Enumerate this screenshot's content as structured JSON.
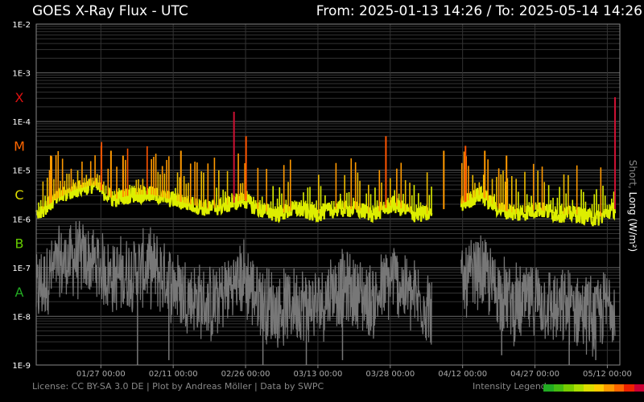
{
  "header": {
    "title": "GOES X-Ray Flux - UTC",
    "range": "From: 2025-01-13 14:26  /  To: 2025-05-14 14:26"
  },
  "footer": {
    "credits": "License: CC BY-SA 3.0 DE | Plot by Andreas Möller | Data by SWPC",
    "legend_title": "Intensity Legend",
    "legend_colors": [
      "#22aa22",
      "#44bb11",
      "#77cc00",
      "#aadd00",
      "#dddd00",
      "#ffcc00",
      "#ff9900",
      "#ff6600",
      "#ee2200",
      "#cc0033",
      "#aa0066",
      "#880088"
    ]
  },
  "axis": {
    "right_label_short": "Short",
    "right_label_sep": ", ",
    "right_label_long": "Long (W/m²)"
  },
  "chart_data": {
    "type": "line",
    "title": "GOES X-Ray Flux - UTC",
    "x_range": [
      "2025-01-13 14:26",
      "2025-05-14 14:26"
    ],
    "x_ticks": [
      "01/27 00:00",
      "02/11 00:00",
      "02/26 00:00",
      "03/13 00:00",
      "03/28 00:00",
      "04/12 00:00",
      "04/27 00:00",
      "05/12 00:00"
    ],
    "x_tick_days": [
      13.4,
      28.4,
      43.4,
      58.4,
      73.4,
      88.4,
      103.4,
      118.4
    ],
    "y_scale": "log",
    "ylim": [
      1e-09,
      0.01
    ],
    "y_ticks": [
      "1E-2",
      "1E-3",
      "1E-4",
      "1E-5",
      "1E-6",
      "1E-7",
      "1E-8",
      "1E-9"
    ],
    "y_tick_exps": [
      -2,
      -3,
      -4,
      -5,
      -6,
      -7,
      -8,
      -9
    ],
    "classes": [
      {
        "label": "X",
        "exp": -3.5,
        "color": "#dd1111"
      },
      {
        "label": "M",
        "exp": -4.5,
        "color": "#ff6600"
      },
      {
        "label": "C",
        "exp": -5.5,
        "color": "#dddd00"
      },
      {
        "label": "B",
        "exp": -6.5,
        "color": "#66cc00"
      },
      {
        "label": "A",
        "exp": -7.5,
        "color": "#22aa22"
      }
    ],
    "ylabel": "Short, Long (W/m²)",
    "grid": true,
    "series": [
      {
        "name": "Long",
        "color": "#ddee00",
        "x_days": [
          0,
          4,
          8,
          12,
          16,
          20,
          24,
          28,
          32,
          36,
          40,
          43,
          46,
          50,
          54,
          58,
          62,
          66,
          70,
          74,
          78,
          82,
          84,
          88,
          92,
          96,
          100,
          104,
          108,
          112,
          116,
          120
        ],
        "log_flux": [
          -5.9,
          -5.6,
          -5.4,
          -5.3,
          -5.6,
          -5.5,
          -5.5,
          -5.6,
          -5.7,
          -5.8,
          -5.7,
          -5.6,
          -5.8,
          -5.9,
          -5.8,
          -5.9,
          -5.8,
          -5.8,
          -5.9,
          -5.7,
          -5.9,
          -5.9,
          null,
          -5.7,
          -5.5,
          -5.8,
          -5.9,
          -5.8,
          -5.9,
          -5.9,
          -6.0,
          -5.8
        ],
        "peaks": [
          {
            "day": 3.0,
            "log_flux": -4.7
          },
          {
            "day": 13.5,
            "log_flux": -4.5
          },
          {
            "day": 15.5,
            "log_flux": -4.6
          },
          {
            "day": 18.0,
            "log_flux": -4.7
          },
          {
            "day": 30.0,
            "log_flux": -4.6
          },
          {
            "day": 41.0,
            "log_flux": -3.8
          },
          {
            "day": 43.5,
            "log_flux": -4.3
          },
          {
            "day": 72.5,
            "log_flux": -4.3
          },
          {
            "day": 84.5,
            "log_flux": -4.6
          },
          {
            "day": 89.0,
            "log_flux": -4.5
          },
          {
            "day": 93.0,
            "log_flux": -4.6
          },
          {
            "day": 97.5,
            "log_flux": -4.7
          },
          {
            "day": 120.0,
            "log_flux": -3.5
          }
        ]
      },
      {
        "name": "Short",
        "color": "#777777",
        "x_days": [
          0,
          4,
          8,
          12,
          16,
          20,
          24,
          28,
          32,
          36,
          40,
          43,
          46,
          50,
          54,
          58,
          62,
          66,
          70,
          74,
          78,
          82,
          84,
          88,
          92,
          96,
          100,
          104,
          108,
          112,
          116,
          120
        ],
        "log_flux": [
          -7.5,
          -7.0,
          -6.8,
          -6.9,
          -7.2,
          -7.1,
          -7.0,
          -7.3,
          -7.6,
          -7.8,
          -7.4,
          -7.2,
          -7.6,
          -7.9,
          -7.7,
          -7.8,
          -7.4,
          -7.5,
          -7.7,
          -7.2,
          -7.6,
          -7.8,
          null,
          -7.4,
          -7.1,
          -7.5,
          -7.8,
          -7.6,
          -7.9,
          -7.8,
          -8.0,
          -7.6
        ],
        "dips": [
          {
            "day": 21.0,
            "log_flux": -9.0
          },
          {
            "day": 27.5,
            "log_flux": -8.9
          },
          {
            "day": 47.0,
            "log_flux": -9.0
          },
          {
            "day": 56.0,
            "log_flux": -9.0
          },
          {
            "day": 63.5,
            "log_flux": -8.9
          },
          {
            "day": 96.5,
            "log_flux": -8.8
          },
          {
            "day": 110.5,
            "log_flux": -9.0
          },
          {
            "day": 116.0,
            "log_flux": -8.9
          }
        ]
      }
    ]
  }
}
